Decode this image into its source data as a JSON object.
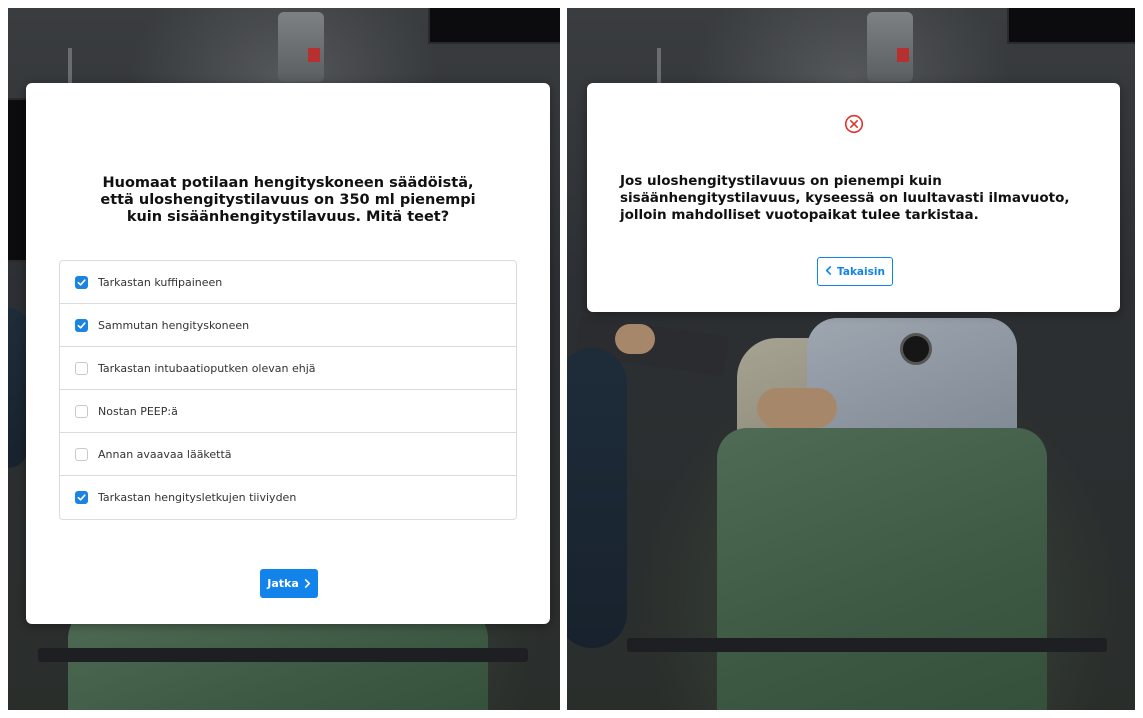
{
  "left_screen": {
    "question": "Huomaat potilaan hengityskoneen säädöistä, että uloshengitystilavuus on 350 ml pienempi kuin sisäänhengitystilavuus. Mitä teet?",
    "options": [
      {
        "label": "Tarkastan kuffipaineen",
        "checked": true
      },
      {
        "label": "Sammutan hengityskoneen",
        "checked": true
      },
      {
        "label": "Tarkastan intubaatioputken olevan ehjä",
        "checked": false
      },
      {
        "label": "Nostan PEEP:ä",
        "checked": false
      },
      {
        "label": "Annan avaavaa lääkettä",
        "checked": false
      },
      {
        "label": "Tarkastan hengitysletkujen tiiviyden",
        "checked": true
      }
    ],
    "continue_button": {
      "label": "Jatka",
      "icon": "chevron-right-icon"
    }
  },
  "right_screen": {
    "status_icon": "error-circle-x-icon",
    "feedback_text": "Jos uloshengitystilavuus on pienempi kuin sisäänhengitystilavuus, kyseessä on luultavasti ilmavuoto, jolloin mahdolliset vuotopaikat tulee tarkistaa.",
    "back_button": {
      "label": "Takaisin",
      "icon": "chevron-left-icon"
    }
  },
  "colors": {
    "accent": "#1283ea",
    "checkbox_checked": "#1a84e0",
    "error": "#e0342c",
    "modal_bg": "#ffffff"
  }
}
